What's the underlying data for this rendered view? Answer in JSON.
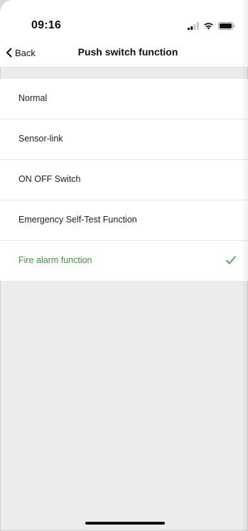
{
  "status_bar": {
    "time": "09:16",
    "icons": [
      "signal-icon",
      "wifi-icon",
      "battery-icon"
    ]
  },
  "nav": {
    "back_label": "Back",
    "title": "Push switch function"
  },
  "options": [
    {
      "label": "Normal",
      "selected": false
    },
    {
      "label": "Sensor-link",
      "selected": false
    },
    {
      "label": "ON OFF Switch",
      "selected": false
    },
    {
      "label": "Emergency Self-Test Function",
      "selected": false
    },
    {
      "label": "Fire alarm function",
      "selected": true
    }
  ],
  "colors": {
    "accent": "#3c9a3a",
    "background": "#ececec",
    "surface": "#ffffff"
  }
}
